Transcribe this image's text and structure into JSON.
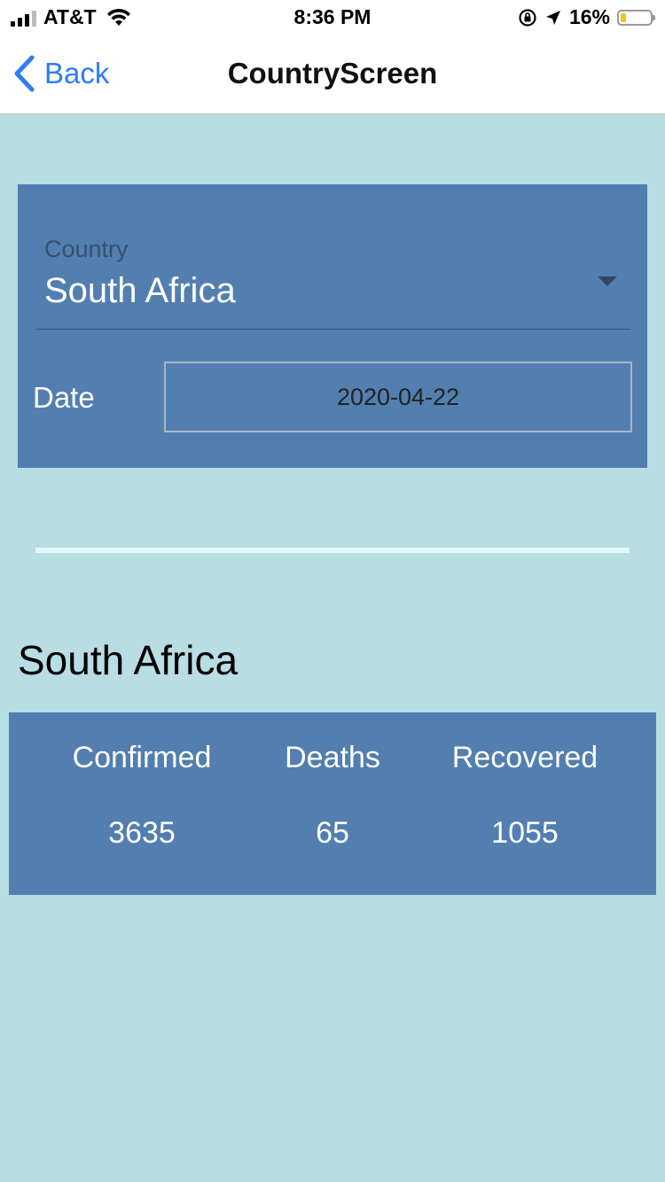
{
  "status_bar": {
    "carrier": "AT&T",
    "time": "8:36 PM",
    "battery_percent": "16%",
    "icons": [
      "signal-icon",
      "wifi-icon",
      "orientation-lock-icon",
      "location-arrow-icon",
      "battery-icon"
    ]
  },
  "nav": {
    "back_label": "Back",
    "title": "CountryScreen",
    "accent_color": "#2f7cf6"
  },
  "form": {
    "country_label": "Country",
    "country_value": "South Africa",
    "date_label": "Date",
    "date_value": "2020-04-22"
  },
  "result": {
    "country": "South Africa",
    "stats": [
      {
        "label": "Confirmed",
        "value": "3635"
      },
      {
        "label": "Deaths",
        "value": "65"
      },
      {
        "label": "Recovered",
        "value": "1055"
      }
    ]
  },
  "colors": {
    "background": "#b8dde2",
    "card": "#527fb0"
  }
}
